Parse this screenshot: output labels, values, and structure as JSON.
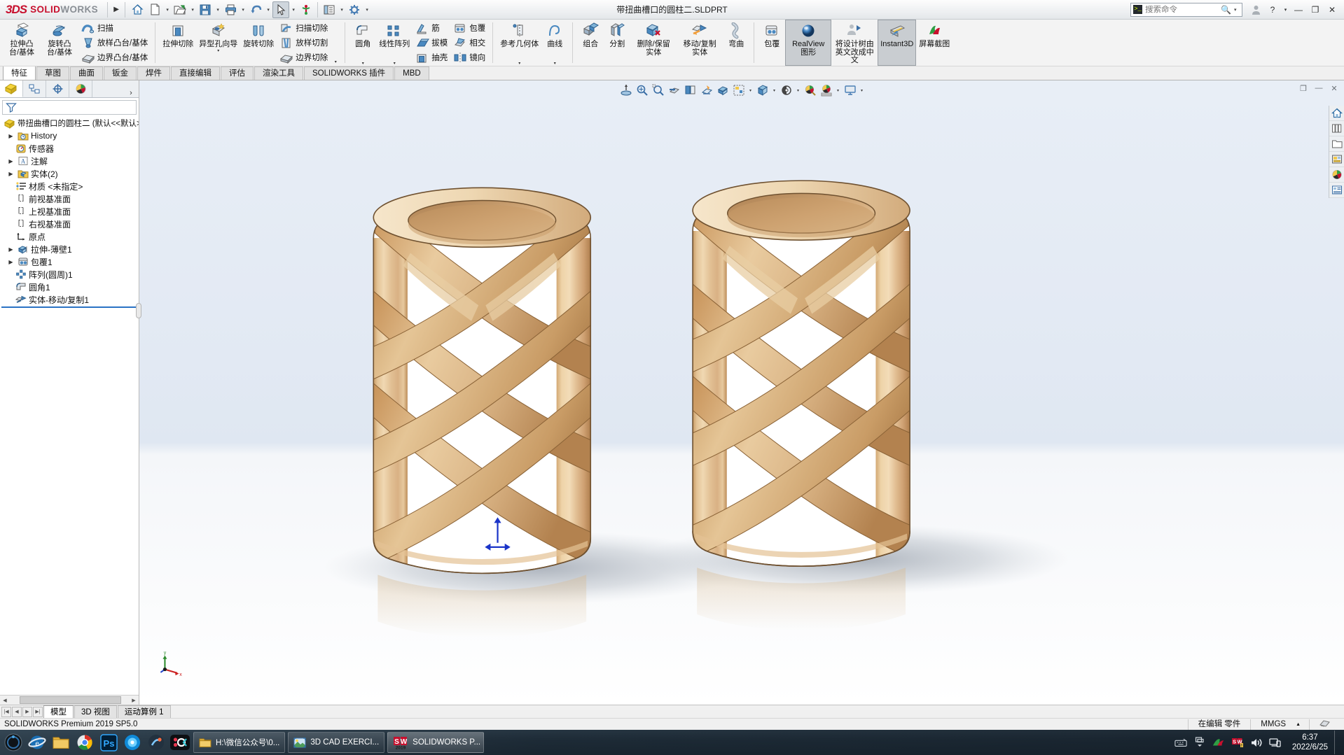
{
  "titlebar": {
    "brand_ds": "3DS",
    "brand_solid": "SOLID",
    "brand_works": "WORKS",
    "document_title": "带扭曲槽口的圆柱二.SLDPRT",
    "quick_access": [
      {
        "name": "home-icon",
        "label": "主页"
      },
      {
        "name": "new-document-icon",
        "label": "新建"
      },
      {
        "name": "open-folder-icon",
        "label": "打开"
      },
      {
        "name": "save-icon",
        "label": "保存"
      },
      {
        "name": "print-icon",
        "label": "打印"
      },
      {
        "name": "undo-icon",
        "label": "撤销"
      },
      {
        "name": "select-cursor-icon",
        "label": "选择"
      },
      {
        "name": "rebuild-icon",
        "label": "重建模型"
      },
      {
        "name": "display-options-icon",
        "label": "显示"
      },
      {
        "name": "options-gear-icon",
        "label": "选项"
      }
    ],
    "search": {
      "placeholder": "搜索命令",
      "value": ""
    },
    "help_label": "?",
    "minimize": "—",
    "restore": "❐",
    "close": "✕"
  },
  "ribbon": {
    "groups": [
      {
        "name": "boss-group",
        "big": [
          {
            "label": "拉伸凸台/基体",
            "icon": "extrude-boss-icon"
          },
          {
            "label": "旋转凸台/基体",
            "icon": "revolve-boss-icon"
          }
        ],
        "rows": [
          {
            "label": "扫描",
            "icon": "sweep-icon"
          },
          {
            "label": "放样凸台/基体",
            "icon": "loft-boss-icon"
          },
          {
            "label": "边界凸台/基体",
            "icon": "boundary-boss-icon"
          }
        ]
      },
      {
        "name": "cut-group",
        "big": [
          {
            "label": "拉伸切除",
            "icon": "extrude-cut-icon"
          },
          {
            "label": "异型孔向导",
            "icon": "hole-wizard-icon",
            "dropdown": true
          },
          {
            "label": "旋转切除",
            "icon": "revolve-cut-icon"
          }
        ],
        "rows": [
          {
            "label": "扫描切除",
            "icon": "swept-cut-icon"
          },
          {
            "label": "放样切割",
            "icon": "lofted-cut-icon"
          },
          {
            "label": "边界切除",
            "icon": "boundary-cut-icon"
          }
        ]
      },
      {
        "name": "feature-group",
        "big": [
          {
            "label": "圆角",
            "icon": "fillet-icon",
            "dropdown": true
          },
          {
            "label": "线性阵列",
            "icon": "linear-pattern-icon",
            "dropdown": true
          }
        ],
        "rows": [
          {
            "label": "筋",
            "icon": "rib-icon"
          },
          {
            "label": "拔模",
            "icon": "draft-icon"
          },
          {
            "label": "抽壳",
            "icon": "shell-icon"
          }
        ],
        "rows2": [
          {
            "label": "包覆",
            "icon": "wrap-icon"
          },
          {
            "label": "相交",
            "icon": "intersect-icon"
          },
          {
            "label": "镜向",
            "icon": "mirror-icon"
          }
        ]
      },
      {
        "name": "reference-group",
        "big": [
          {
            "label": "参考几何体",
            "icon": "reference-geometry-icon",
            "dropdown": true
          },
          {
            "label": "曲线",
            "icon": "curves-icon",
            "dropdown": true
          }
        ]
      },
      {
        "name": "bodies-group",
        "big": [
          {
            "label": "组合",
            "icon": "combine-icon"
          },
          {
            "label": "分割",
            "icon": "split-icon"
          },
          {
            "label": "删除/保留实体",
            "icon": "delete-keep-body-icon"
          },
          {
            "label": "移动/复制实体",
            "icon": "move-copy-body-icon"
          },
          {
            "label": "弯曲",
            "icon": "flex-icon"
          }
        ]
      },
      {
        "name": "display-group",
        "big": [
          {
            "label": "包覆",
            "icon": "wrap-icon"
          },
          {
            "label": "RealView 图形",
            "icon": "realview-sphere-icon",
            "active": true
          },
          {
            "label": "将设计树由英文改成中文",
            "icon": "translate-tree-icon"
          },
          {
            "label": "Instant3D",
            "icon": "instant3d-icon",
            "active": true
          },
          {
            "label": "屏幕截图",
            "icon": "screen-capture-icon"
          }
        ]
      }
    ]
  },
  "command_tabs": {
    "items": [
      "特征",
      "草图",
      "曲面",
      "钣金",
      "焊件",
      "直接编辑",
      "评估",
      "渲染工具",
      "SOLIDWORKS 插件",
      "MBD"
    ],
    "selected": "特征"
  },
  "manager_panel": {
    "tabs": [
      {
        "name": "feature-manager-tab",
        "icon": "feature-tree-icon",
        "selected": true
      },
      {
        "name": "property-manager-tab",
        "icon": "property-manager-icon",
        "selected": false
      },
      {
        "name": "configuration-manager-tab",
        "icon": "configuration-icon",
        "selected": false
      },
      {
        "name": "display-manager-tab",
        "icon": "display-manager-icon",
        "selected": false
      }
    ],
    "more": "›",
    "filter": {
      "name": "filter-icon",
      "placeholder": ""
    },
    "tree": [
      {
        "label": "带扭曲槽口的圆柱二  (默认<<默认>_显",
        "icon": "part-icon",
        "expandable": false,
        "indent": 0,
        "root": true
      },
      {
        "label": "History",
        "icon": "history-icon",
        "expandable": true,
        "indent": 1
      },
      {
        "label": "传感器",
        "icon": "sensor-icon",
        "expandable": false,
        "indent": 1
      },
      {
        "label": "注解",
        "icon": "annotations-icon",
        "expandable": true,
        "indent": 1
      },
      {
        "label": "实体(2)",
        "icon": "solid-bodies-icon",
        "expandable": true,
        "indent": 1
      },
      {
        "label": "材质 <未指定>",
        "icon": "material-icon",
        "expandable": false,
        "indent": 1
      },
      {
        "label": "前视基准面",
        "icon": "plane-icon",
        "expandable": false,
        "indent": 1
      },
      {
        "label": "上视基准面",
        "icon": "plane-icon",
        "expandable": false,
        "indent": 1
      },
      {
        "label": "右视基准面",
        "icon": "plane-icon",
        "expandable": false,
        "indent": 1
      },
      {
        "label": "原点",
        "icon": "origin-icon",
        "expandable": false,
        "indent": 1
      },
      {
        "label": "拉伸-薄壁1",
        "icon": "extrude-thin-icon",
        "expandable": true,
        "indent": 1
      },
      {
        "label": "包覆1",
        "icon": "wrap-feature-icon",
        "expandable": true,
        "indent": 1
      },
      {
        "label": "阵列(圆周)1",
        "icon": "circular-pattern-icon",
        "expandable": false,
        "indent": 1
      },
      {
        "label": "圆角1",
        "icon": "fillet-feature-icon",
        "expandable": false,
        "indent": 1
      },
      {
        "label": "实体-移动/复制1",
        "icon": "move-copy-feature-icon",
        "expandable": false,
        "indent": 1
      }
    ]
  },
  "view_toolbar": {
    "items": [
      {
        "name": "zoom-to-fit-icon",
        "label": "整屏显示全图"
      },
      {
        "name": "zoom-to-area-icon",
        "label": "局部放大"
      },
      {
        "name": "previous-view-icon",
        "label": "上一视图"
      },
      {
        "name": "section-view-icon",
        "label": "剖面视图"
      },
      {
        "name": "view-orientation-icon",
        "label": "视图定向"
      },
      {
        "name": "display-style-icon",
        "label": "显示样式"
      },
      {
        "name": "hide-show-items-icon",
        "label": "隐藏/显示项目"
      },
      {
        "name": "edit-appearance-icon",
        "label": "编辑外观"
      },
      {
        "name": "apply-scene-icon",
        "label": "应用布景"
      },
      {
        "name": "view-settings-icon",
        "label": "视图设定"
      }
    ]
  },
  "right_toolbar": {
    "items": [
      {
        "name": "home-panel-icon",
        "label": "主页"
      },
      {
        "name": "design-library-icon",
        "label": "设计库"
      },
      {
        "name": "file-explorer-icon",
        "label": "文件探索器"
      },
      {
        "name": "view-palette-icon",
        "label": "视图调色板"
      },
      {
        "name": "appearances-icon",
        "label": "外观、布景和贴图"
      },
      {
        "name": "custom-properties-icon",
        "label": "自定义属性"
      }
    ]
  },
  "viewport": {
    "model_name": "带扭曲槽口的圆柱二",
    "triad_labels": {
      "x": "x",
      "y": "y",
      "z": "z"
    }
  },
  "doc_tabs": {
    "items": [
      "模型",
      "3D 视图",
      "运动算例 1"
    ],
    "selected": "模型"
  },
  "status_bar": {
    "left": "SOLIDWORKS Premium 2019 SP5.0",
    "edit_state": "在编辑 零件",
    "units": "MMGS",
    "units_caret": "▲"
  },
  "taskbar": {
    "start_icon": "start-orb-icon",
    "pinned": [
      {
        "name": "ie-icon",
        "label": "Internet Explorer"
      },
      {
        "name": "folder-icon",
        "label": "文件资源管理器"
      },
      {
        "name": "chrome-icon",
        "label": "浏览器"
      },
      {
        "name": "photoshop-icon",
        "label": "Ps"
      },
      {
        "name": "app5-icon",
        "label": "应用"
      },
      {
        "name": "app6-icon",
        "label": "应用"
      },
      {
        "name": "app7-icon",
        "label": "应用"
      }
    ],
    "windows": [
      {
        "name": "explorer-window",
        "label": "H:\\微信公众号\\0...",
        "icon": "folder-icon",
        "active": false
      },
      {
        "name": "image-window",
        "label": "3D CAD EXERCI...",
        "icon": "picture-icon",
        "active": false
      },
      {
        "name": "solidworks-window",
        "label": "SOLIDWORKS P...",
        "icon": "solidworks-icon",
        "active": true
      }
    ],
    "tray": [
      {
        "name": "keyboard-icon"
      },
      {
        "name": "tray-expand-icon"
      },
      {
        "name": "nvidia-icon"
      },
      {
        "name": "solidworks-tray-icon"
      },
      {
        "name": "volume-icon"
      },
      {
        "name": "network-icon"
      }
    ],
    "clock_time": "6:37",
    "clock_date": "2022/6/25"
  },
  "colors": {
    "brand_red": "#c8102e",
    "accent_blue": "#2a72c4",
    "ribbon_bg": "#f3f3f3",
    "wood_light": "#e8cfa8",
    "wood_mid": "#d9b684",
    "wood_dark": "#b58a56",
    "viewport_top": "#e6edf6",
    "viewport_bottom": "#ffffff"
  }
}
